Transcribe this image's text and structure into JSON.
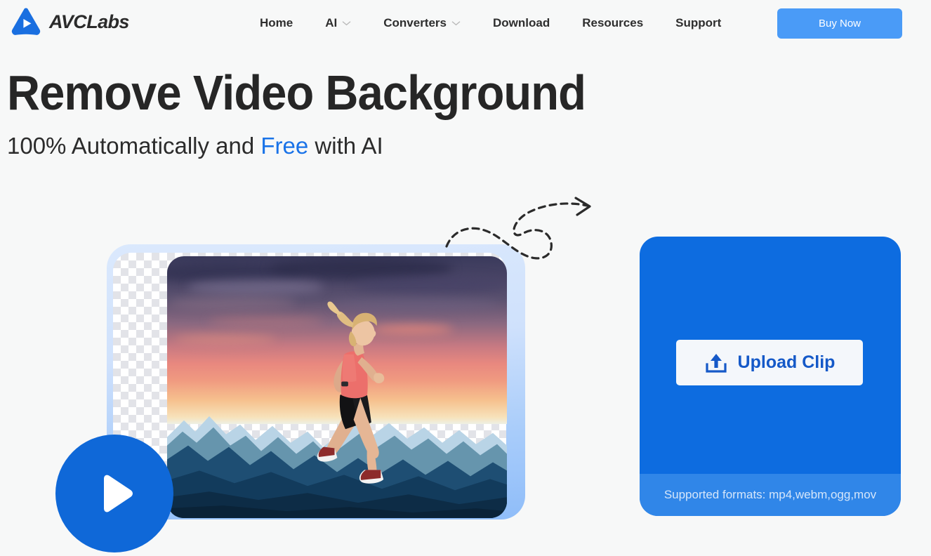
{
  "header": {
    "brand": {
      "name": "AVCLabs",
      "logo_icon": "avclabs-play-triangle-logo"
    },
    "nav": [
      {
        "label": "Home",
        "has_dropdown": false
      },
      {
        "label": "AI",
        "has_dropdown": true
      },
      {
        "label": "Converters",
        "has_dropdown": true
      },
      {
        "label": "Download",
        "has_dropdown": false
      },
      {
        "label": "Resources",
        "has_dropdown": false
      },
      {
        "label": "Support",
        "has_dropdown": false
      }
    ],
    "buy_button": {
      "label": "Buy Now",
      "color": "#4a9bf7"
    }
  },
  "hero": {
    "title": "Remove Video Background",
    "subtitle_before": "100% Automatically and ",
    "subtitle_accent": "Free",
    "subtitle_after": " with AI",
    "accent_color": "#1a73e8"
  },
  "preview": {
    "play_button_icon": "play-icon",
    "arrow_icon": "dashed-curved-arrow-icon",
    "thumbnail_alt": "woman running with mountain sunset background"
  },
  "upload": {
    "button_label": "Upload Clip",
    "button_icon": "upload-icon",
    "formats_text": "Supported formats: mp4,webm,ogg,mov",
    "panel_color": "#0d6ce0",
    "footer_color": "#3086e8"
  },
  "page": {
    "background_color": "#f7f8f8"
  }
}
